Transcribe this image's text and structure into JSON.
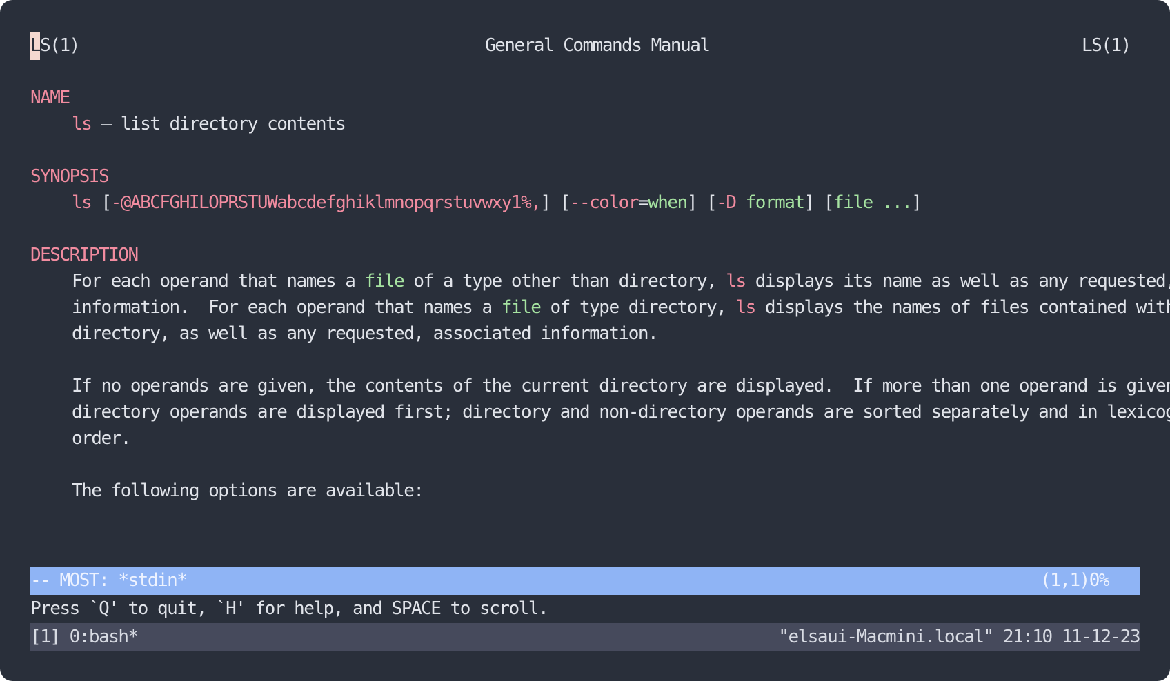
{
  "header": {
    "left_cursor_char": "L",
    "left_rest": "S(1)",
    "center": "General Commands Manual",
    "right": "LS(1)"
  },
  "name_section": {
    "title": "NAME",
    "cmd": "ls",
    "desc": " – list directory contents"
  },
  "synopsis_section": {
    "title": "SYNOPSIS",
    "cmd": "ls",
    "b1_open": " [",
    "flags": "-@ABCFGHILOPRSTUWabcdefghiklmnopqrstuvwxy1%,",
    "b1_close": "] [",
    "color_opt": "--color",
    "eq": "=",
    "when": "when",
    "b2_close": "] [",
    "d_opt": "-D",
    "space": " ",
    "format": "format",
    "b3_close": "] [",
    "file": "file ...",
    "b4_close": "]"
  },
  "description_section": {
    "title": "DESCRIPTION",
    "p1_l1_a": "For each operand that names a ",
    "p1_l1_file": "file",
    "p1_l1_b": " of a type other than directory, ",
    "p1_l1_ls": "ls",
    "p1_l1_c": " displays its name as well as any requested, associated",
    "p1_l2_a": "information.  For each operand that names a ",
    "p1_l2_file": "file",
    "p1_l2_b": " of type directory, ",
    "p1_l2_ls": "ls",
    "p1_l2_c": " displays the names of files contained within that",
    "p1_l3": "directory, as well as any requested, associated information.",
    "p2_l1": "If no operands are given, the contents of the current directory are displayed.  If more than one operand is given, non-",
    "p2_l2": "directory operands are displayed first; directory and non-directory operands are sorted separately and in lexicographical",
    "p2_l3": "order.",
    "p3_l1": "The following options are available:"
  },
  "most_bar": {
    "left": "-- MOST: *stdin*",
    "right": "(1,1)0%"
  },
  "help_line": "Press `Q' to quit, `H' for help, and SPACE to scroll.",
  "tmux_status": {
    "left": "[1] 0:bash*",
    "right": "\"elsaui-Macmini.local\" 21:10 11-12-23"
  },
  "colors": {
    "background": "#292f3a",
    "text": "#e1e4ea",
    "heading_pink": "#f28ca0",
    "arg_green": "#a6e3a1",
    "most_bar": "#8fb4f5",
    "status_bar": "#464a5c"
  }
}
